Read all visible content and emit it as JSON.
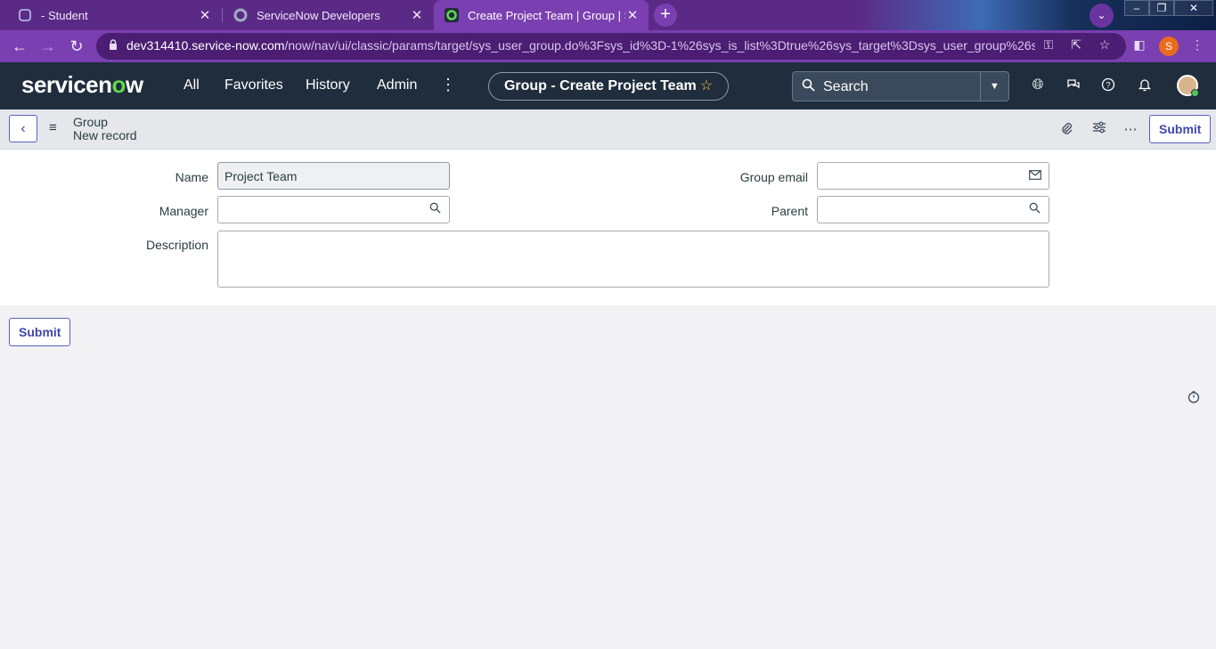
{
  "browser": {
    "tabs": [
      {
        "title": "- Student",
        "active": false
      },
      {
        "title": "ServiceNow Developers",
        "active": false
      },
      {
        "title": "Create Project Team | Group | Ser",
        "active": true
      }
    ],
    "new_tab": "+",
    "url_host": "dev314410.service-now.com",
    "url_path": "/now/nav/ui/classic/params/target/sys_user_group.do%3Fsys_id%3D-1%26sys_is_list%3Dtrue%26sys_target%3Dsys_user_group%26sys...",
    "profile_initial": "S"
  },
  "header": {
    "logo_pre": "servicen",
    "logo_o": "o",
    "logo_post": "w",
    "menu": [
      "All",
      "Favorites",
      "History",
      "Admin"
    ],
    "context_title": "Group - Create Project Team",
    "search_label": "Search"
  },
  "form_header": {
    "table": "Group",
    "record": "New record",
    "submit_label": "Submit"
  },
  "form": {
    "name_label": "Name",
    "name_value": "Project Team",
    "manager_label": "Manager",
    "manager_value": "",
    "description_label": "Description",
    "group_email_label": "Group email",
    "group_email_value": "",
    "parent_label": "Parent",
    "parent_value": ""
  },
  "bottom_submit_label": "Submit",
  "colors": {
    "tab_strip": "#5b2a86",
    "address_bar": "#7a3fb0",
    "sn_header": "#1f2d3d",
    "logo_accent": "#62d84e",
    "button_accent": "#3f47a8"
  }
}
